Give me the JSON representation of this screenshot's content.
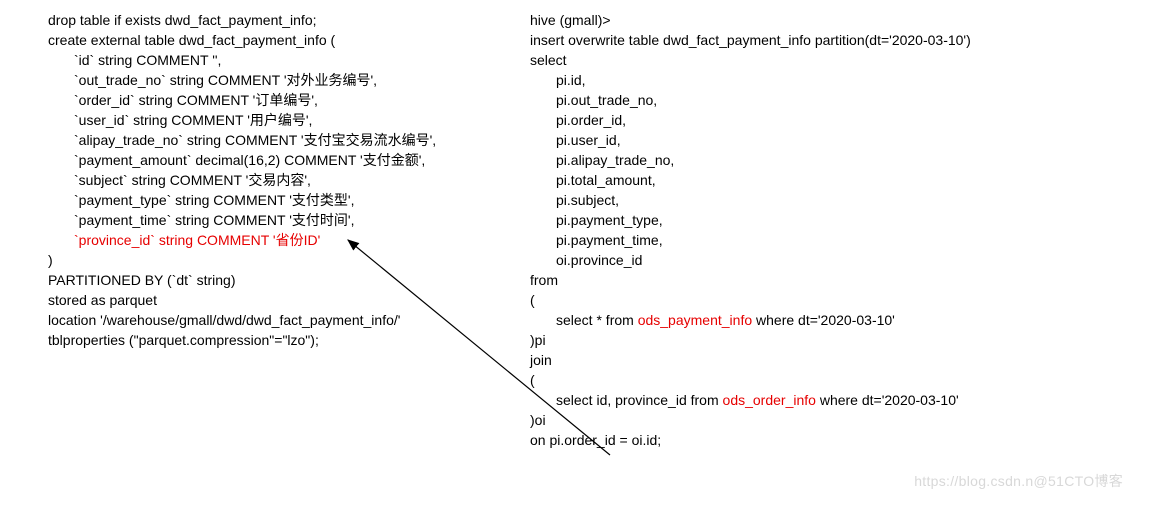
{
  "left": {
    "l1": "drop table if exists dwd_fact_payment_info;",
    "l2": "create external table dwd_fact_payment_info (",
    "l3": "`id` string COMMENT '',",
    "l4": "`out_trade_no` string COMMENT '对外业务编号',",
    "l5": "`order_id` string COMMENT '订单编号',",
    "l6": "`user_id` string COMMENT '用户编号',",
    "l7": "`alipay_trade_no` string COMMENT '支付宝交易流水编号',",
    "l8": "`payment_amount`    decimal(16,2) COMMENT '支付金额',",
    "l9": "`subject`         string COMMENT '交易内容',",
    "l10": "`payment_type` string COMMENT '支付类型',",
    "l11": "`payment_time` string COMMENT '支付时间',",
    "l12": "`province_id` string COMMENT '省份ID'",
    "l13": ")",
    "l14": "PARTITIONED BY (`dt` string)",
    "l15": "stored as parquet",
    "l16": "location '/warehouse/gmall/dwd/dwd_fact_payment_info/'",
    "l17": "tblproperties (\"parquet.compression\"=\"lzo\");"
  },
  "right": {
    "r1": "hive (gmall)>",
    "r2": "insert overwrite table dwd_fact_payment_info partition(dt='2020-03-10')",
    "r3": "select",
    "r4": "pi.id,",
    "r5": "pi.out_trade_no,",
    "r6": "pi.order_id,",
    "r7": "pi.user_id,",
    "r8": "pi.alipay_trade_no,",
    "r9": "pi.total_amount,",
    "r10": "pi.subject,",
    "r11": "pi.payment_type,",
    "r12": "pi.payment_time,",
    "r13": "oi.province_id",
    "r14": "from",
    "r15": "(",
    "r16a": "select * from ",
    "r16b": "ods_payment_info",
    "r16c": " where dt='2020-03-10'",
    "r17": ")pi",
    "r18": "join",
    "r19": "(",
    "r20a": "select id, province_id from ",
    "r20b": "ods_order_info",
    "r20c": " where dt='2020-03-10'",
    "r21": ")oi",
    "r22": "on pi.order_id = oi.id;"
  },
  "watermark": "https://blog.csdn.n@51CTO博客"
}
